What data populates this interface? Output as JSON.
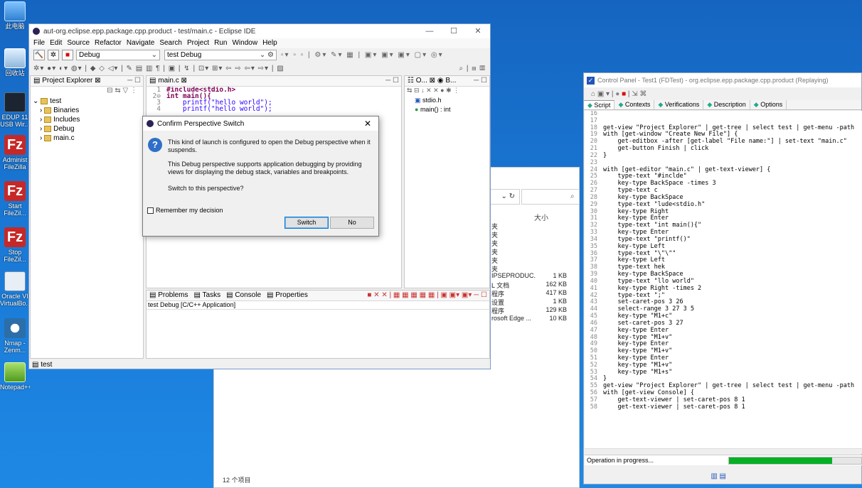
{
  "desktop": {
    "icons": [
      {
        "label": "此电脑",
        "icon": "computer-icon"
      },
      {
        "label": "回收站",
        "icon": "recycle-bin-icon"
      },
      {
        "label": "EDUP 11\nUSB Wir...",
        "icon": "usb-wireless-icon"
      },
      {
        "label": "Administ\nFileZilla S...",
        "icon": "filezilla-icon"
      },
      {
        "label": "Start\nFileZil...",
        "icon": "filezilla-icon"
      },
      {
        "label": "Stop\nFileZil...",
        "icon": "filezilla-icon"
      },
      {
        "label": "Oracle VI\nVirtualBo...",
        "icon": "virtualbox-icon"
      },
      {
        "label": "Nmap -\nZenm...",
        "icon": "nmap-icon"
      },
      {
        "label": "Notepad++",
        "icon": "notepad-plus-icon"
      }
    ]
  },
  "explorer": {
    "column_size": "大小",
    "status": "12 个项目",
    "rows": [
      {
        "name": "夹",
        "size": ""
      },
      {
        "name": "夹",
        "size": ""
      },
      {
        "name": "夹",
        "size": ""
      },
      {
        "name": "夹",
        "size": ""
      },
      {
        "name": "夹",
        "size": ""
      },
      {
        "name": "夹",
        "size": ""
      },
      {
        "name": "IPSEPRODUC...",
        "size": "1 KB"
      },
      {
        "name": "L 文档",
        "size": "162 KB"
      },
      {
        "name": "程序",
        "size": "417 KB"
      },
      {
        "name": "设置",
        "size": "1 KB"
      },
      {
        "name": "程序",
        "size": "129 KB"
      },
      {
        "name": "rosoft Edge ...",
        "size": "10 KB"
      }
    ]
  },
  "eclipse": {
    "title": "aut-org.eclipse.epp.package.cpp.product - test/main.c - Eclipse IDE",
    "menu": [
      "File",
      "Edit",
      "Source",
      "Refactor",
      "Navigate",
      "Search",
      "Project",
      "Run",
      "Window",
      "Help"
    ],
    "launch_mode": "Debug",
    "launch_config": "test Debug",
    "project_explorer": {
      "title": "Project Explorer",
      "project": "test",
      "children": [
        "Binaries",
        "Includes",
        "Debug",
        "main.c"
      ]
    },
    "editor": {
      "tab": "main.c",
      "lines": [
        {
          "n": "1",
          "text": "#include<stdio.h>"
        },
        {
          "n": "2⊖",
          "text": "int main(){"
        },
        {
          "n": "3",
          "text": "    printf(\"hello world\");"
        },
        {
          "n": "4",
          "text": "    printf(\"hello world\");"
        }
      ]
    },
    "outline": {
      "tab1": "O...",
      "tab2": "B...",
      "items": [
        "stdio.h",
        "main() : int"
      ]
    },
    "bottom": {
      "tabs": [
        "Problems",
        "Tasks",
        "Console",
        "Properties"
      ],
      "console_title": "test Debug [C/C++ Application]"
    },
    "status_left": "test"
  },
  "dialog": {
    "title": "Confirm Perspective Switch",
    "para1": "This kind of launch is configured to open the Debug perspective when it suspends.",
    "para2": "This Debug perspective supports application debugging by providing views for displaying the debug stack, variables and breakpoints.",
    "para3": "Switch to this perspective?",
    "remember": "Remember my decision",
    "switch": "Switch",
    "no": "No"
  },
  "control_panel": {
    "title": "Control Panel - Test1 (FDTest) - org.eclipse.epp.package.cpp.product (Replaying)",
    "tabs": [
      "Script",
      "Contexts",
      "Verifications",
      "Description",
      "Options"
    ],
    "status": "Operation in progress...",
    "progress_fraction": 0.78,
    "script_lines": [
      {
        "n": "16",
        "t": ""
      },
      {
        "n": "17",
        "t": ""
      },
      {
        "n": "18",
        "t": "get-view \"Project Explorer\" | get-tree | select test | get-menu -path"
      },
      {
        "n": "19",
        "t": "with [get-window \"Create New File\"] {"
      },
      {
        "n": "20",
        "t": "    get-editbox -after [get-label \"File name:\"] | set-text \"main.c\""
      },
      {
        "n": "21",
        "t": "    get-button Finish | click"
      },
      {
        "n": "22",
        "t": "}"
      },
      {
        "n": "23",
        "t": ""
      },
      {
        "n": "24",
        "t": "with [get-editor \"main.c\" | get-text-viewer] {"
      },
      {
        "n": "25",
        "t": "    type-text \"#inclde\""
      },
      {
        "n": "26",
        "t": "    key-type BackSpace -times 3"
      },
      {
        "n": "27",
        "t": "    type-text c"
      },
      {
        "n": "28",
        "t": "    key-type BackSpace"
      },
      {
        "n": "29",
        "t": "    type-text \"lude<stdio.h\""
      },
      {
        "n": "30",
        "t": "    key-type Right"
      },
      {
        "n": "31",
        "t": "    key-type Enter"
      },
      {
        "n": "32",
        "t": "    type-text \"int main(){\""
      },
      {
        "n": "33",
        "t": "    key-type Enter"
      },
      {
        "n": "34",
        "t": "    type-text \"printf()\""
      },
      {
        "n": "35",
        "t": "    key-type Left"
      },
      {
        "n": "36",
        "t": "    type-text \"\\\"\\\"\""
      },
      {
        "n": "37",
        "t": "    key-type Left"
      },
      {
        "n": "38",
        "t": "    type-text hek"
      },
      {
        "n": "39",
        "t": "    key-type BackSpace"
      },
      {
        "n": "40",
        "t": "    type-text \"llo world\""
      },
      {
        "n": "41",
        "t": "    key-type Right -times 2"
      },
      {
        "n": "42",
        "t": "    type-text \";\""
      },
      {
        "n": "43",
        "t": "    set-caret-pos 3 26"
      },
      {
        "n": "44",
        "t": "    select-range 3 27 3 5"
      },
      {
        "n": "45",
        "t": "    key-type \"M1+c\""
      },
      {
        "n": "46",
        "t": "    set-caret-pos 3 27"
      },
      {
        "n": "47",
        "t": "    key-type Enter"
      },
      {
        "n": "48",
        "t": "    key-type \"M1+v\""
      },
      {
        "n": "49",
        "t": "    key-type Enter"
      },
      {
        "n": "50",
        "t": "    key-type \"M1+v\""
      },
      {
        "n": "51",
        "t": "    key-type Enter"
      },
      {
        "n": "52",
        "t": "    key-type \"M1+v\""
      },
      {
        "n": "53",
        "t": "    key-type \"M1+s\""
      },
      {
        "n": "54",
        "t": "}"
      },
      {
        "n": "55",
        "t": "get-view \"Project Explorer\" | get-tree | select test | get-menu -path"
      },
      {
        "n": "56",
        "t": "with [get-view Console] {"
      },
      {
        "n": "57",
        "t": "    get-text-viewer | set-caret-pos 8 1"
      },
      {
        "n": "58",
        "t": "    get-text-viewer | set-caret-pos 8 1"
      }
    ]
  }
}
